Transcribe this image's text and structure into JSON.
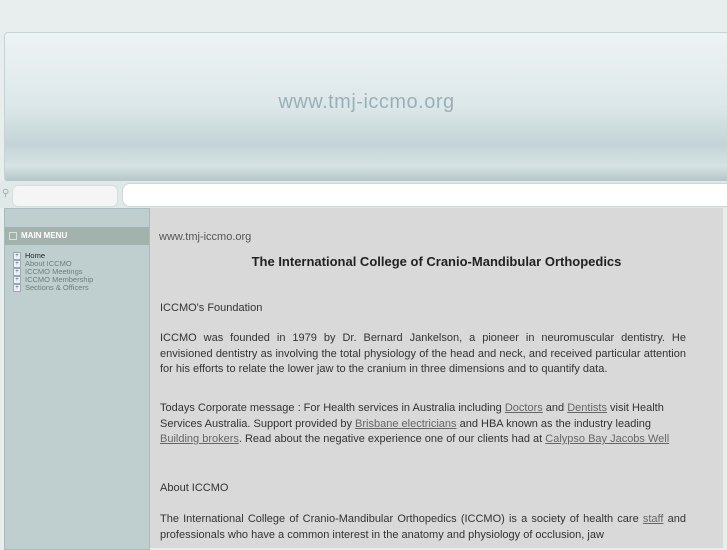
{
  "banner": {
    "title": "www.tmj-iccmo.org"
  },
  "sidebar": {
    "heading": "MAIN MENU",
    "items": [
      "Home",
      "About ICCMO",
      "ICCMO Meetings",
      "ICCMO Membership",
      "Sections & Officers"
    ]
  },
  "main": {
    "site": "www.tmj-iccmo.org",
    "title": "The International College of Cranio-Mandibular Orthopedics",
    "foundation_heading": "ICCMO's Foundation",
    "foundation_text": "ICCMO was founded in 1979 by Dr. Bernard Jankelson, a pioneer in neuromuscular dentistry. He envisioned dentistry as involving the total physiology of the head and neck, and received particular attention for his efforts to relate the lower jaw to the cranium in three dimensions and to quantify data.",
    "corp": {
      "t1": "Todays Corporate message : For Health services in Australia including ",
      "l1": "Doctors",
      "t2": " and ",
      "l2": "Dentists",
      "t3": " visit Health Services Australia. Support provided by ",
      "l3": "Brisbane electricians",
      "t4": " and HBA known as the industry leading ",
      "l4": "Building brokers",
      "t5": ". Read about the negative experience one of our clients had at ",
      "l5": "Calypso Bay Jacobs Well"
    },
    "about_heading": "About ICCMO",
    "about": {
      "t1": "The International College of Cranio-Mandibular Orthopedics (ICCMO) is a society of health care ",
      "l1": "staff",
      "t2": " and professionals who have a common interest in the anatomy and physiology of occlusion, jaw"
    }
  }
}
